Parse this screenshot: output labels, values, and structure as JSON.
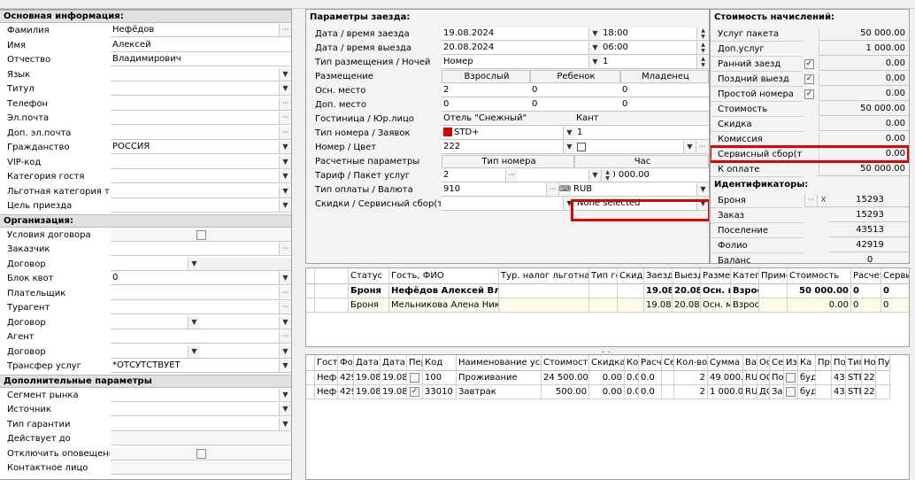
{
  "basic": {
    "title": "Основная информация:",
    "rows": [
      {
        "label": "Фамилия",
        "value": "Нефёдов",
        "btn": "dots"
      },
      {
        "label": "Имя",
        "value": "Алексей",
        "btn": ""
      },
      {
        "label": "Отчество",
        "value": "Владимирович",
        "btn": ""
      },
      {
        "label": "Язык",
        "value": "",
        "btn": "drop"
      },
      {
        "label": "Титул",
        "value": "",
        "btn": "drop"
      },
      {
        "label": "Телефон",
        "value": "",
        "btn": "dots"
      },
      {
        "label": "Эл.почта",
        "value": "",
        "btn": "dots"
      },
      {
        "label": "Доп. эл.почта",
        "value": "",
        "btn": "dots"
      },
      {
        "label": "Гражданство",
        "value": "РОССИЯ",
        "btn": "drop"
      },
      {
        "label": "VIP-код",
        "value": "",
        "btn": "drop"
      },
      {
        "label": "Категория гостя",
        "value": "",
        "btn": "drop"
      },
      {
        "label": "Льготная категория тур.",
        "value": "",
        "btn": "drop"
      },
      {
        "label": "Цель приезда",
        "value": "",
        "btn": "drop"
      }
    ]
  },
  "org": {
    "title": "Организация:",
    "rows": [
      {
        "label": "Условия договора",
        "value": "",
        "btn": "check"
      },
      {
        "label": "Заказчик",
        "value": "",
        "btn": "dots"
      },
      {
        "label": "Договор",
        "value": "",
        "btn": "drop-mid"
      },
      {
        "label": "Блок квот",
        "value": "0",
        "btn": "drop"
      },
      {
        "label": "Плательщик",
        "value": "",
        "btn": "dots"
      },
      {
        "label": "Турагент",
        "value": "",
        "btn": "dots"
      },
      {
        "label": "Договор",
        "value": "",
        "btn": "drop-both"
      },
      {
        "label": "Агент",
        "value": "",
        "btn": "dots"
      },
      {
        "label": "Договор",
        "value": "",
        "btn": "drop-both"
      },
      {
        "label": "Трансфер услуг",
        "value": "*ОТСУТСТВУЕТ",
        "btn": "drop"
      }
    ]
  },
  "extra": {
    "title": "Дополнительные параметры",
    "rows": [
      {
        "label": "Сегмент рынка",
        "value": "",
        "btn": "drop"
      },
      {
        "label": "Источник",
        "value": "",
        "btn": "drop"
      },
      {
        "label": "Тип гарантии",
        "value": "",
        "btn": "drop"
      },
      {
        "label": "Действует до",
        "value": "",
        "btn": "none"
      },
      {
        "label": "Отключить оповещения",
        "value": "",
        "btn": "check"
      },
      {
        "label": "Контактное лицо",
        "value": "",
        "btn": "none"
      }
    ]
  },
  "stay": {
    "title": "Параметры заезда:",
    "arrival_label": "Дата / время заезда",
    "arrival_date": "19.08.2024",
    "arrival_time": "18:00",
    "departure_label": "Дата / время выезда",
    "departure_date": "20.08.2024",
    "departure_time": "06:00",
    "placement_label": "Тип размещения / Ночей",
    "placement": "Номер",
    "nights": "1",
    "acc_label": "Размещение",
    "col_adult": "Взрослый",
    "col_child": "Ребенок",
    "col_infant": "Младенец",
    "main_label": "Осн. место",
    "main": [
      "2",
      "0",
      "0"
    ],
    "extra_label": "Доп. место",
    "extra": [
      "0",
      "0",
      "0"
    ],
    "hotel_label": "Гостиница / Юр.лицо",
    "hotel": "Отель \"Снежный\"",
    "legal": "Кант",
    "roomtype_label": "Тип номера / Заявок",
    "roomtype": "STD+",
    "requests": "1",
    "room_label": "Номер / Цвет",
    "room": "222",
    "calc_label": "Расчетные параметры",
    "calc_col1": "Тип номера",
    "calc_col2": "Час",
    "tariff_label": "Тариф / Пакет услуг",
    "tariff": "2",
    "package_price": "50 000.00",
    "pay_label": "Тип оплаты / Валюта",
    "pay": "910",
    "currency": "RUB",
    "discount_label": "Скидки / Сервисный сбор(тур.н.",
    "service_fee": "None selected",
    "roomtype_color": "#d40000"
  },
  "cost": {
    "title": "Стоимость начислений:",
    "rows": [
      {
        "label": "Услуг пакета",
        "value": "50 000.00",
        "check": null
      },
      {
        "label": "Доп.услуг",
        "value": "1 000.00",
        "check": null
      },
      {
        "label": "Ранний заезд",
        "value": "0.00",
        "check": true
      },
      {
        "label": "Поздний выезд",
        "value": "0.00",
        "check": true
      },
      {
        "label": "Простой номера",
        "value": "0.00",
        "check": true
      },
      {
        "label": "Стоимость",
        "value": "50 000.00",
        "check": null
      },
      {
        "label": "Скидка",
        "value": "0.00",
        "check": null
      },
      {
        "label": "Комиссия",
        "value": "0.00",
        "check": null
      },
      {
        "label": "Сервисный сбор(тур.",
        "value": "0.00",
        "check": null
      },
      {
        "label": "К оплате",
        "value": "50 000.00",
        "check": null
      }
    ]
  },
  "ids": {
    "title": "Идентификаторы:",
    "rows": [
      {
        "label": "Броня",
        "value": "15293"
      },
      {
        "label": "Заказ",
        "value": "15293"
      },
      {
        "label": "Поселение",
        "value": "43513"
      },
      {
        "label": "Фолио",
        "value": "42919"
      },
      {
        "label": "Баланс",
        "value": "0"
      }
    ]
  },
  "guests": {
    "headers": [
      "Статус",
      "Гость, ФИО",
      "Тур. налог льготная к",
      "Тип го",
      "Скидка",
      "Заезд",
      "Выезд",
      "Размещ",
      "Катего",
      "Примеч",
      "Стоимость",
      "Расчет",
      "Сервис"
    ],
    "rows": [
      [
        "Броня",
        "Нефёдов Алексей Владим",
        "",
        "",
        "",
        "19.08.",
        "20.08.",
        "Осн. м",
        "Взросл",
        "",
        "50 000.00",
        "0",
        "0"
      ],
      [
        "Броня",
        "Мельникова Алена Николае",
        "",
        "",
        "",
        "19.08.",
        "20.08.",
        "Осн. м",
        "Взросл",
        "",
        "0.00",
        "0",
        "0"
      ]
    ]
  },
  "services": {
    "headers": [
      "Гость",
      "Фо",
      "Дата",
      "Дата",
      "Пер",
      "Код",
      "Наименование услуг",
      "Стоимость",
      "Скидка",
      "Ко",
      "Расче",
      "Се",
      "Кол-во",
      "Сумма",
      "Ва",
      "Ос",
      "Се",
      "Изм",
      "Ка",
      "При",
      "Пос",
      "Тип",
      "Ном",
      "Пут"
    ],
    "rows": [
      [
        "Нефё",
        "429",
        "19.08",
        "19.08",
        "",
        "100",
        "Проживание",
        "24 500.00",
        "0.00",
        "0.0",
        "0.0",
        "",
        "2",
        "49 000.0",
        "RUI",
        "ОС",
        "Пос",
        "",
        "буд",
        "",
        "435",
        "STE",
        "222",
        ""
      ],
      [
        "Нефё",
        "429",
        "19.08",
        "19.08",
        "✓",
        "33010",
        "Завтрак",
        "500.00",
        "0.00",
        "0.0",
        "0.0",
        "",
        "2",
        "1 000.0",
        "RUI",
        "ДС",
        "Зав",
        "",
        "буд",
        "",
        "435",
        "STE",
        "222",
        ""
      ]
    ]
  }
}
